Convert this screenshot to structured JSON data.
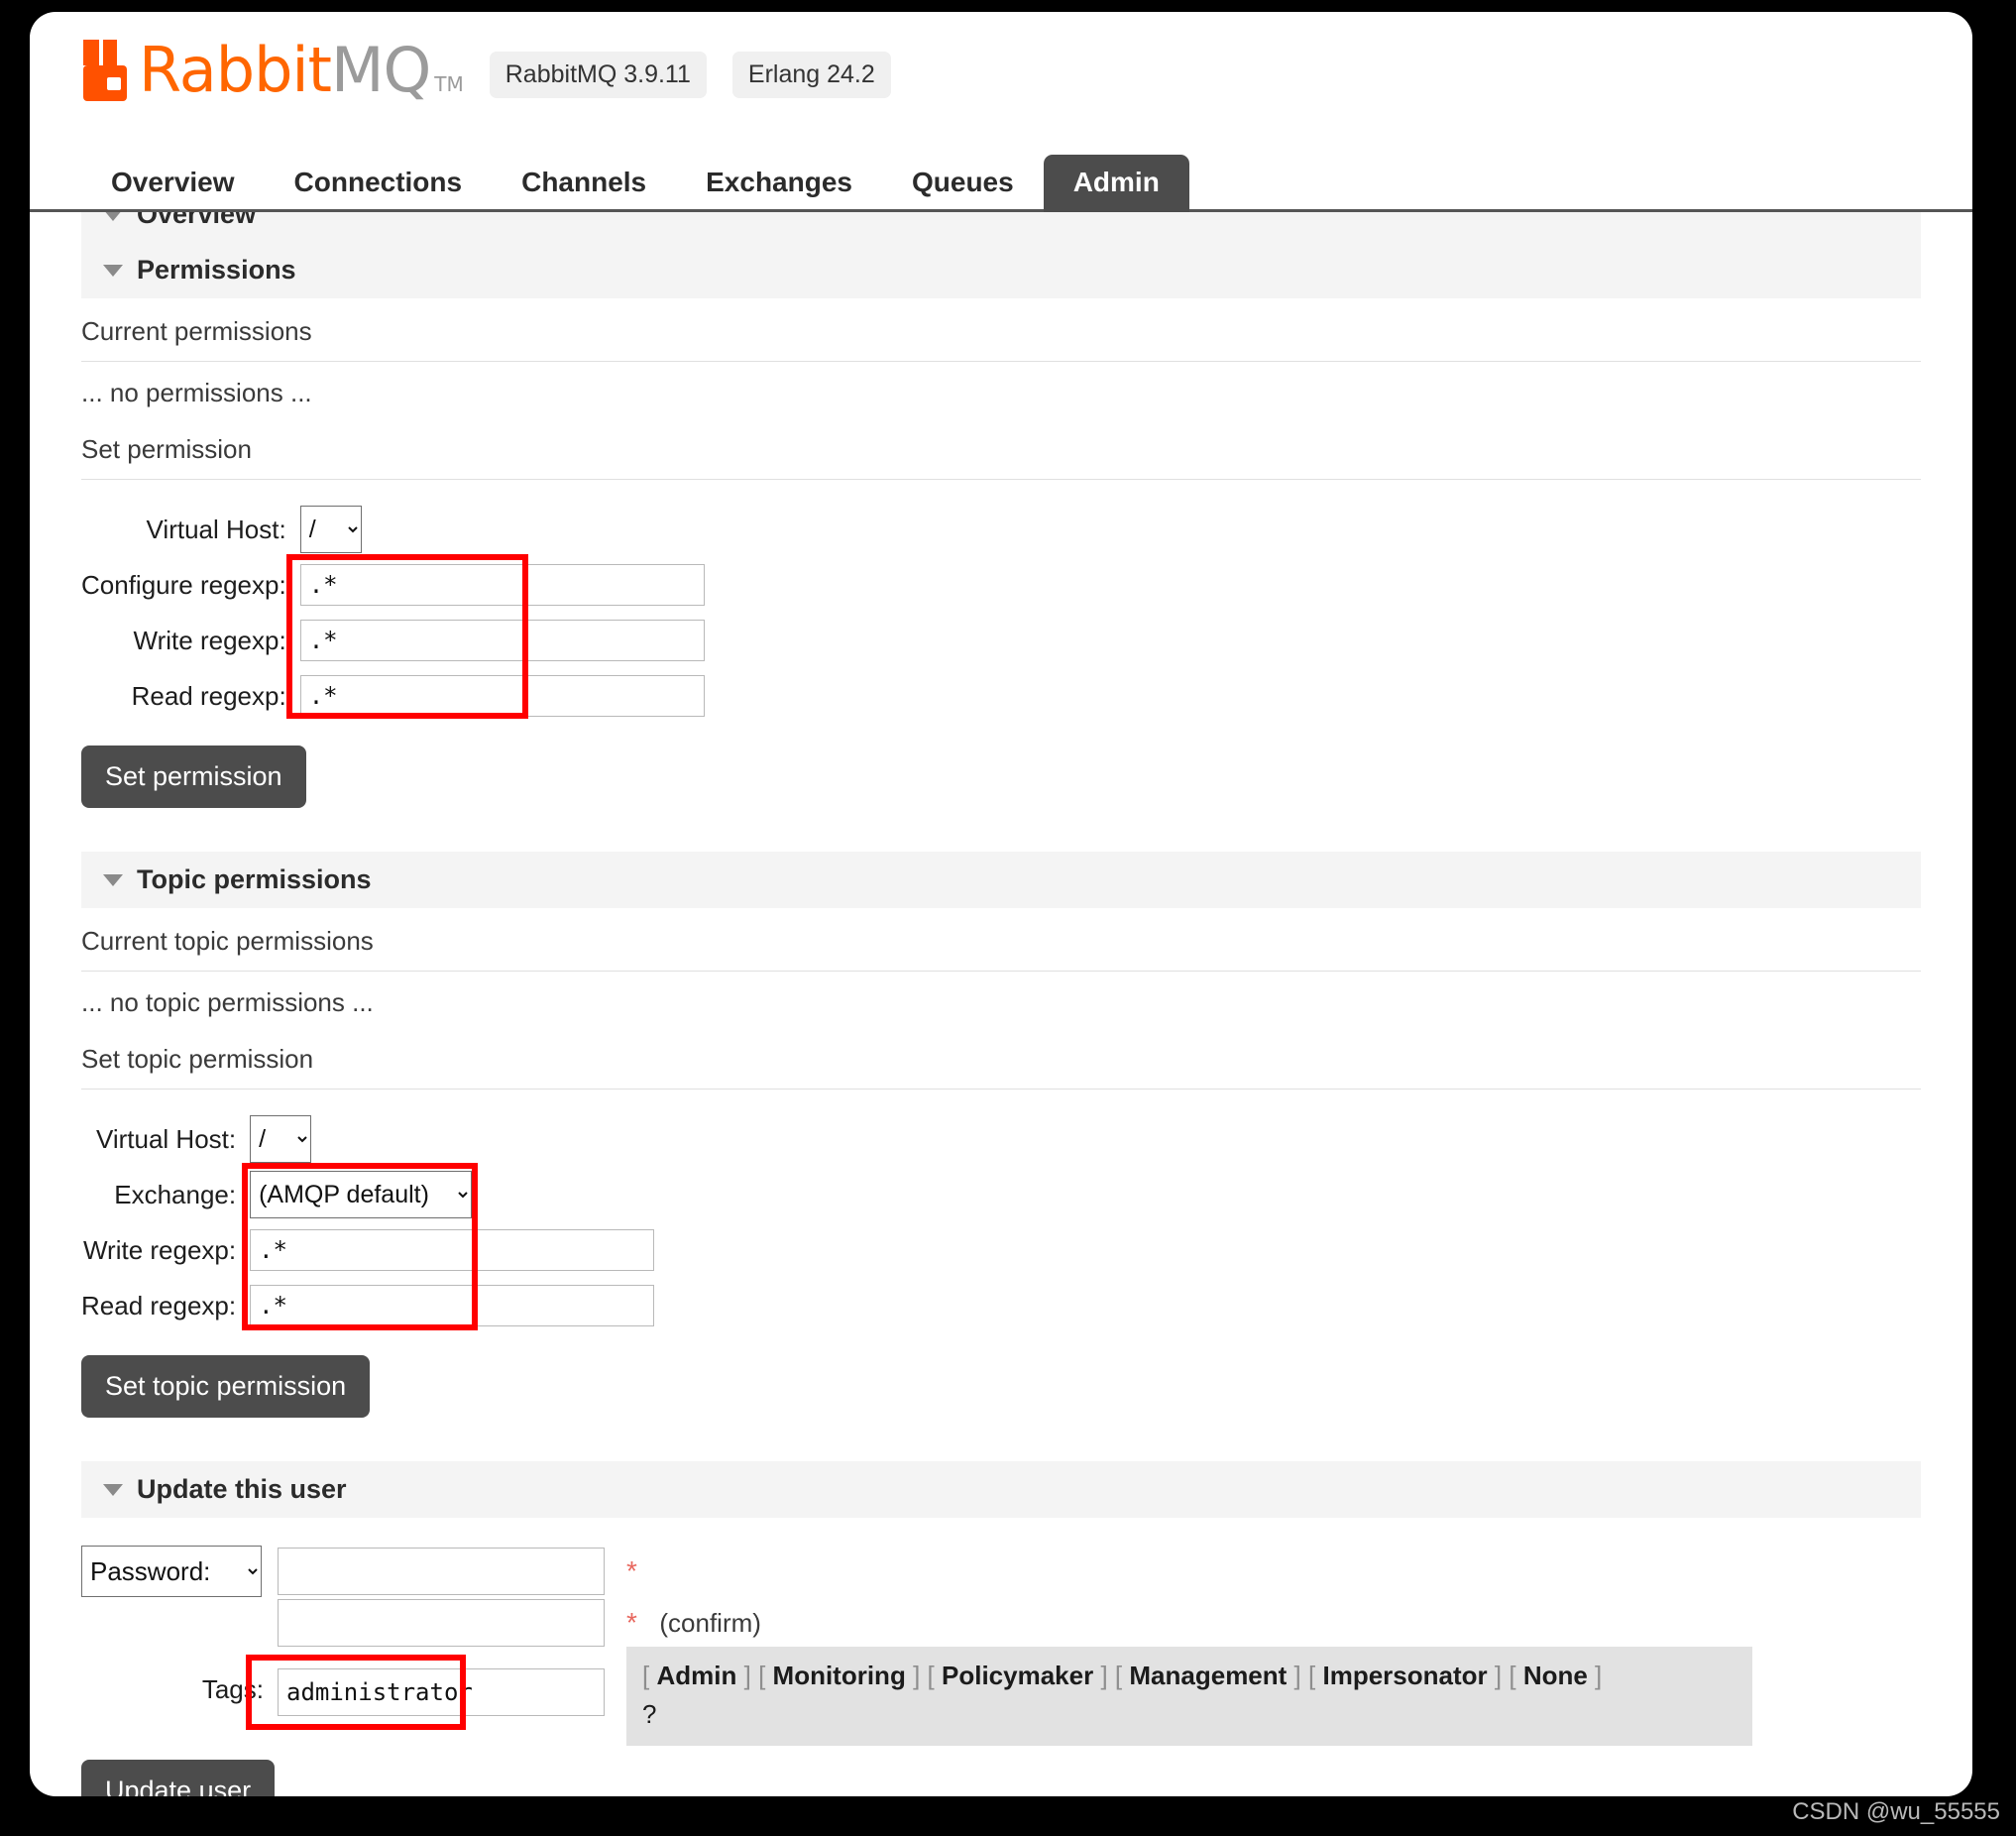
{
  "brand": {
    "name_part1": "Rabbit",
    "name_part2": "MQ",
    "tm": "TM",
    "version_pill": "RabbitMQ 3.9.11",
    "erlang_pill": "Erlang 24.2",
    "accent_color": "#ff6600",
    "logo_icon": "rabbit-logo-icon"
  },
  "nav": {
    "tabs": [
      {
        "label": "Overview",
        "active": false
      },
      {
        "label": "Connections",
        "active": false
      },
      {
        "label": "Channels",
        "active": false
      },
      {
        "label": "Exchanges",
        "active": false
      },
      {
        "label": "Queues",
        "active": false
      },
      {
        "label": "Admin",
        "active": true
      }
    ]
  },
  "clipped_section": {
    "title": "Overview"
  },
  "permissions": {
    "section_title": "Permissions",
    "current_label": "Current permissions",
    "empty_text": "... no permissions ...",
    "set_label": "Set permission",
    "fields": {
      "vhost_label": "Virtual Host:",
      "vhost_value": "/",
      "configure_label": "Configure regexp:",
      "configure_value": ".*",
      "write_label": "Write regexp:",
      "write_value": ".*",
      "read_label": "Read regexp:",
      "read_value": ".*"
    },
    "submit_label": "Set permission"
  },
  "topic_permissions": {
    "section_title": "Topic permissions",
    "current_label": "Current topic permissions",
    "empty_text": "... no topic permissions ...",
    "set_label": "Set topic permission",
    "fields": {
      "vhost_label": "Virtual Host:",
      "vhost_value": "/",
      "exchange_label": "Exchange:",
      "exchange_value": "(AMQP default)",
      "write_label": "Write regexp:",
      "write_value": ".*",
      "read_label": "Read regexp:",
      "read_value": ".*"
    },
    "submit_label": "Set topic permission"
  },
  "update_user": {
    "section_title": "Update this user",
    "password_select_value": "Password:",
    "password_value": "",
    "password_confirm_value": "",
    "required_marker": "*",
    "confirm_label": "(confirm)",
    "tags_label": "Tags:",
    "tags_value": "administrator",
    "tag_links": [
      "Admin",
      "Monitoring",
      "Policymaker",
      "Management",
      "Impersonator",
      "None"
    ],
    "bracket_open": "[",
    "bracket_close": "]",
    "help_marker": "?",
    "submit_label": "Update user"
  },
  "annotations": {
    "highlight_color": "#ff0000",
    "boxes": [
      {
        "name": "permissions-regexp-highlight"
      },
      {
        "name": "topic-permissions-highlight"
      },
      {
        "name": "tags-highlight"
      }
    ]
  },
  "watermark": {
    "text": "CSDN @wu_55555"
  }
}
